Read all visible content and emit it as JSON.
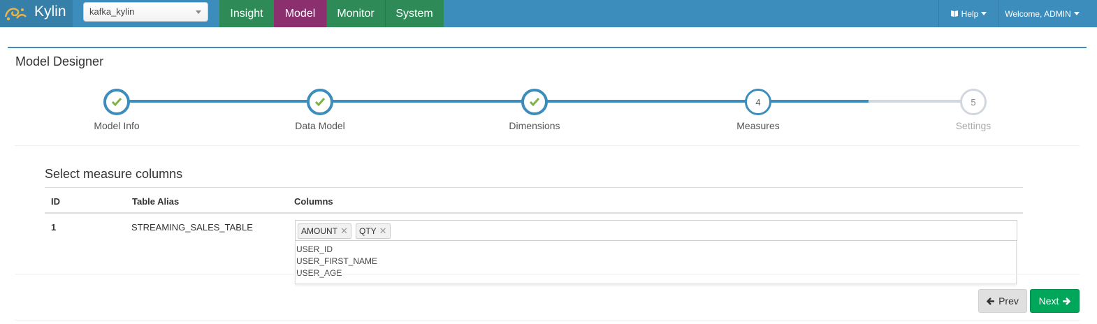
{
  "navbar": {
    "brand": "Kylin",
    "project": "kafka_kylin",
    "tabs": [
      "Insight",
      "Model",
      "Monitor",
      "System"
    ],
    "active_tab": "Model",
    "help": "Help",
    "welcome": "Welcome, ADMIN",
    "colors": {
      "bar": "#3c8dbc",
      "tab": "#2e8b57",
      "active_tab": "#8b2f6f"
    }
  },
  "page": {
    "title": "Model Designer"
  },
  "wizard": {
    "steps": [
      {
        "number": "1",
        "label": "Model Info",
        "status": "done",
        "icon": "check-icon"
      },
      {
        "number": "2",
        "label": "Data Model",
        "status": "done",
        "icon": "check-icon"
      },
      {
        "number": "3",
        "label": "Dimensions",
        "status": "done",
        "icon": "check-icon"
      },
      {
        "number": "4",
        "label": "Measures",
        "status": "active"
      },
      {
        "number": "5",
        "label": "Settings",
        "status": "todo"
      }
    ]
  },
  "measures": {
    "section_title": "Select measure columns",
    "headers": {
      "id": "ID",
      "alias": "Table Alias",
      "columns": "Columns"
    },
    "rows": [
      {
        "id": "1",
        "alias": "STREAMING_SALES_TABLE",
        "selected": [
          "AMOUNT",
          "QTY"
        ],
        "options": [
          "USER_ID",
          "USER_FIRST_NAME",
          "USER_AGE"
        ]
      }
    ]
  },
  "actions": {
    "prev": "Prev",
    "next": "Next"
  }
}
